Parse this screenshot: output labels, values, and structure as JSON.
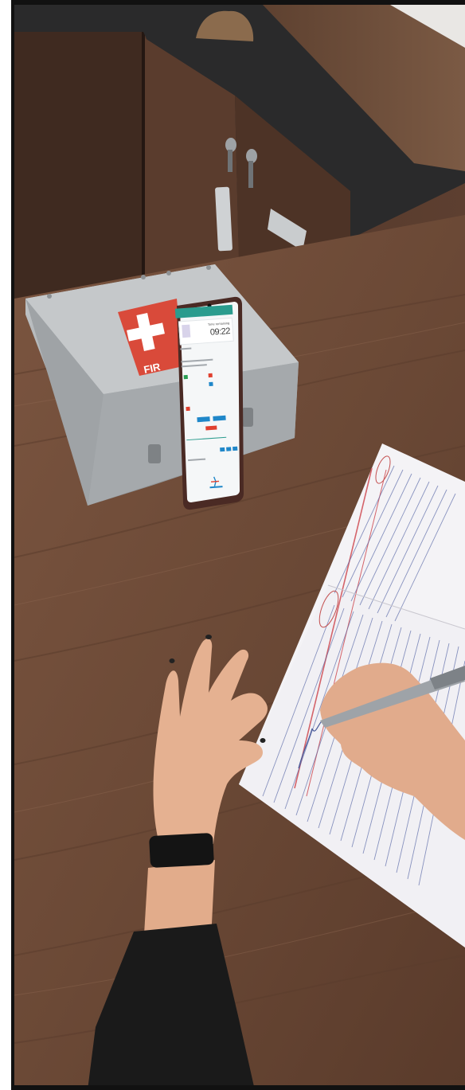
{
  "scene": {
    "phone_app": {
      "timer_label": "Time remaining",
      "timer_value": "09:22"
    }
  },
  "colors": {
    "floor_wood": "#6d4c38",
    "desk_top": "#2a2a2a",
    "cabinet_wood": "#4b3225",
    "first_aid_red": "#d94a3a",
    "paper": "#f4f3f6",
    "paper_rule_blue": "#4a5b9a",
    "paper_margin_red": "#d4636a",
    "app_teal": "#2b9c8e",
    "app_blue": "#1f87c9",
    "app_red": "#e0402f",
    "skin": "#e5b191",
    "sleeve": "#1a1a1a"
  },
  "icons": [
    "first-aid-cross-icon",
    "lock-icon",
    "app-logo-icon"
  ]
}
